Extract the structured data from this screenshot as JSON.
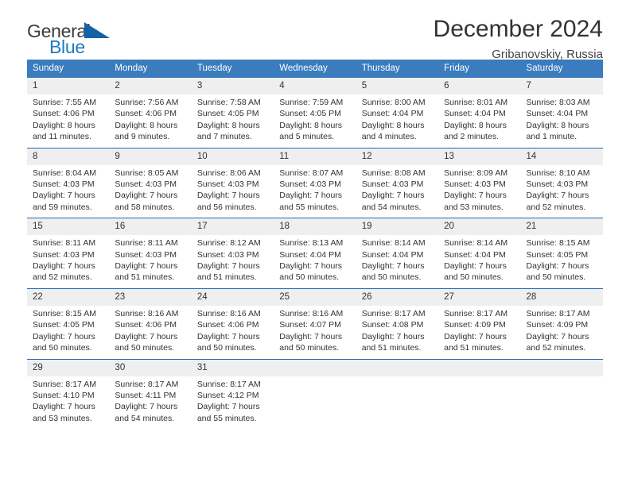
{
  "brand": {
    "name_top": "General",
    "name_bottom": "Blue",
    "triangle_icon": "blue-triangle-logo-mark",
    "color_top": "#3c3c3c",
    "color_bottom": "#1f7ac0",
    "color_triangle": "#1361a6"
  },
  "header": {
    "title": "December 2024",
    "subtitle": "Gribanovskiy, Russia"
  },
  "theme": {
    "header_bar": "#3a7cbe",
    "row_separator": "#1f6cb0",
    "daynum_band": "#efefef",
    "text": "#333333"
  },
  "weekdays": [
    "Sunday",
    "Monday",
    "Tuesday",
    "Wednesday",
    "Thursday",
    "Friday",
    "Saturday"
  ],
  "weeks": [
    [
      {
        "day": "1",
        "sunrise": "Sunrise: 7:55 AM",
        "sunset": "Sunset: 4:06 PM",
        "daylight_line1": "Daylight: 8 hours",
        "daylight_line2": "and 11 minutes."
      },
      {
        "day": "2",
        "sunrise": "Sunrise: 7:56 AM",
        "sunset": "Sunset: 4:06 PM",
        "daylight_line1": "Daylight: 8 hours",
        "daylight_line2": "and 9 minutes."
      },
      {
        "day": "3",
        "sunrise": "Sunrise: 7:58 AM",
        "sunset": "Sunset: 4:05 PM",
        "daylight_line1": "Daylight: 8 hours",
        "daylight_line2": "and 7 minutes."
      },
      {
        "day": "4",
        "sunrise": "Sunrise: 7:59 AM",
        "sunset": "Sunset: 4:05 PM",
        "daylight_line1": "Daylight: 8 hours",
        "daylight_line2": "and 5 minutes."
      },
      {
        "day": "5",
        "sunrise": "Sunrise: 8:00 AM",
        "sunset": "Sunset: 4:04 PM",
        "daylight_line1": "Daylight: 8 hours",
        "daylight_line2": "and 4 minutes."
      },
      {
        "day": "6",
        "sunrise": "Sunrise: 8:01 AM",
        "sunset": "Sunset: 4:04 PM",
        "daylight_line1": "Daylight: 8 hours",
        "daylight_line2": "and 2 minutes."
      },
      {
        "day": "7",
        "sunrise": "Sunrise: 8:03 AM",
        "sunset": "Sunset: 4:04 PM",
        "daylight_line1": "Daylight: 8 hours",
        "daylight_line2": "and 1 minute."
      }
    ],
    [
      {
        "day": "8",
        "sunrise": "Sunrise: 8:04 AM",
        "sunset": "Sunset: 4:03 PM",
        "daylight_line1": "Daylight: 7 hours",
        "daylight_line2": "and 59 minutes."
      },
      {
        "day": "9",
        "sunrise": "Sunrise: 8:05 AM",
        "sunset": "Sunset: 4:03 PM",
        "daylight_line1": "Daylight: 7 hours",
        "daylight_line2": "and 58 minutes."
      },
      {
        "day": "10",
        "sunrise": "Sunrise: 8:06 AM",
        "sunset": "Sunset: 4:03 PM",
        "daylight_line1": "Daylight: 7 hours",
        "daylight_line2": "and 56 minutes."
      },
      {
        "day": "11",
        "sunrise": "Sunrise: 8:07 AM",
        "sunset": "Sunset: 4:03 PM",
        "daylight_line1": "Daylight: 7 hours",
        "daylight_line2": "and 55 minutes."
      },
      {
        "day": "12",
        "sunrise": "Sunrise: 8:08 AM",
        "sunset": "Sunset: 4:03 PM",
        "daylight_line1": "Daylight: 7 hours",
        "daylight_line2": "and 54 minutes."
      },
      {
        "day": "13",
        "sunrise": "Sunrise: 8:09 AM",
        "sunset": "Sunset: 4:03 PM",
        "daylight_line1": "Daylight: 7 hours",
        "daylight_line2": "and 53 minutes."
      },
      {
        "day": "14",
        "sunrise": "Sunrise: 8:10 AM",
        "sunset": "Sunset: 4:03 PM",
        "daylight_line1": "Daylight: 7 hours",
        "daylight_line2": "and 52 minutes."
      }
    ],
    [
      {
        "day": "15",
        "sunrise": "Sunrise: 8:11 AM",
        "sunset": "Sunset: 4:03 PM",
        "daylight_line1": "Daylight: 7 hours",
        "daylight_line2": "and 52 minutes."
      },
      {
        "day": "16",
        "sunrise": "Sunrise: 8:11 AM",
        "sunset": "Sunset: 4:03 PM",
        "daylight_line1": "Daylight: 7 hours",
        "daylight_line2": "and 51 minutes."
      },
      {
        "day": "17",
        "sunrise": "Sunrise: 8:12 AM",
        "sunset": "Sunset: 4:03 PM",
        "daylight_line1": "Daylight: 7 hours",
        "daylight_line2": "and 51 minutes."
      },
      {
        "day": "18",
        "sunrise": "Sunrise: 8:13 AM",
        "sunset": "Sunset: 4:04 PM",
        "daylight_line1": "Daylight: 7 hours",
        "daylight_line2": "and 50 minutes."
      },
      {
        "day": "19",
        "sunrise": "Sunrise: 8:14 AM",
        "sunset": "Sunset: 4:04 PM",
        "daylight_line1": "Daylight: 7 hours",
        "daylight_line2": "and 50 minutes."
      },
      {
        "day": "20",
        "sunrise": "Sunrise: 8:14 AM",
        "sunset": "Sunset: 4:04 PM",
        "daylight_line1": "Daylight: 7 hours",
        "daylight_line2": "and 50 minutes."
      },
      {
        "day": "21",
        "sunrise": "Sunrise: 8:15 AM",
        "sunset": "Sunset: 4:05 PM",
        "daylight_line1": "Daylight: 7 hours",
        "daylight_line2": "and 50 minutes."
      }
    ],
    [
      {
        "day": "22",
        "sunrise": "Sunrise: 8:15 AM",
        "sunset": "Sunset: 4:05 PM",
        "daylight_line1": "Daylight: 7 hours",
        "daylight_line2": "and 50 minutes."
      },
      {
        "day": "23",
        "sunrise": "Sunrise: 8:16 AM",
        "sunset": "Sunset: 4:06 PM",
        "daylight_line1": "Daylight: 7 hours",
        "daylight_line2": "and 50 minutes."
      },
      {
        "day": "24",
        "sunrise": "Sunrise: 8:16 AM",
        "sunset": "Sunset: 4:06 PM",
        "daylight_line1": "Daylight: 7 hours",
        "daylight_line2": "and 50 minutes."
      },
      {
        "day": "25",
        "sunrise": "Sunrise: 8:16 AM",
        "sunset": "Sunset: 4:07 PM",
        "daylight_line1": "Daylight: 7 hours",
        "daylight_line2": "and 50 minutes."
      },
      {
        "day": "26",
        "sunrise": "Sunrise: 8:17 AM",
        "sunset": "Sunset: 4:08 PM",
        "daylight_line1": "Daylight: 7 hours",
        "daylight_line2": "and 51 minutes."
      },
      {
        "day": "27",
        "sunrise": "Sunrise: 8:17 AM",
        "sunset": "Sunset: 4:09 PM",
        "daylight_line1": "Daylight: 7 hours",
        "daylight_line2": "and 51 minutes."
      },
      {
        "day": "28",
        "sunrise": "Sunrise: 8:17 AM",
        "sunset": "Sunset: 4:09 PM",
        "daylight_line1": "Daylight: 7 hours",
        "daylight_line2": "and 52 minutes."
      }
    ],
    [
      {
        "day": "29",
        "sunrise": "Sunrise: 8:17 AM",
        "sunset": "Sunset: 4:10 PM",
        "daylight_line1": "Daylight: 7 hours",
        "daylight_line2": "and 53 minutes."
      },
      {
        "day": "30",
        "sunrise": "Sunrise: 8:17 AM",
        "sunset": "Sunset: 4:11 PM",
        "daylight_line1": "Daylight: 7 hours",
        "daylight_line2": "and 54 minutes."
      },
      {
        "day": "31",
        "sunrise": "Sunrise: 8:17 AM",
        "sunset": "Sunset: 4:12 PM",
        "daylight_line1": "Daylight: 7 hours",
        "daylight_line2": "and 55 minutes."
      },
      {
        "day": "",
        "sunrise": "",
        "sunset": "",
        "daylight_line1": "",
        "daylight_line2": ""
      },
      {
        "day": "",
        "sunrise": "",
        "sunset": "",
        "daylight_line1": "",
        "daylight_line2": ""
      },
      {
        "day": "",
        "sunrise": "",
        "sunset": "",
        "daylight_line1": "",
        "daylight_line2": ""
      },
      {
        "day": "",
        "sunrise": "",
        "sunset": "",
        "daylight_line1": "",
        "daylight_line2": ""
      }
    ]
  ]
}
